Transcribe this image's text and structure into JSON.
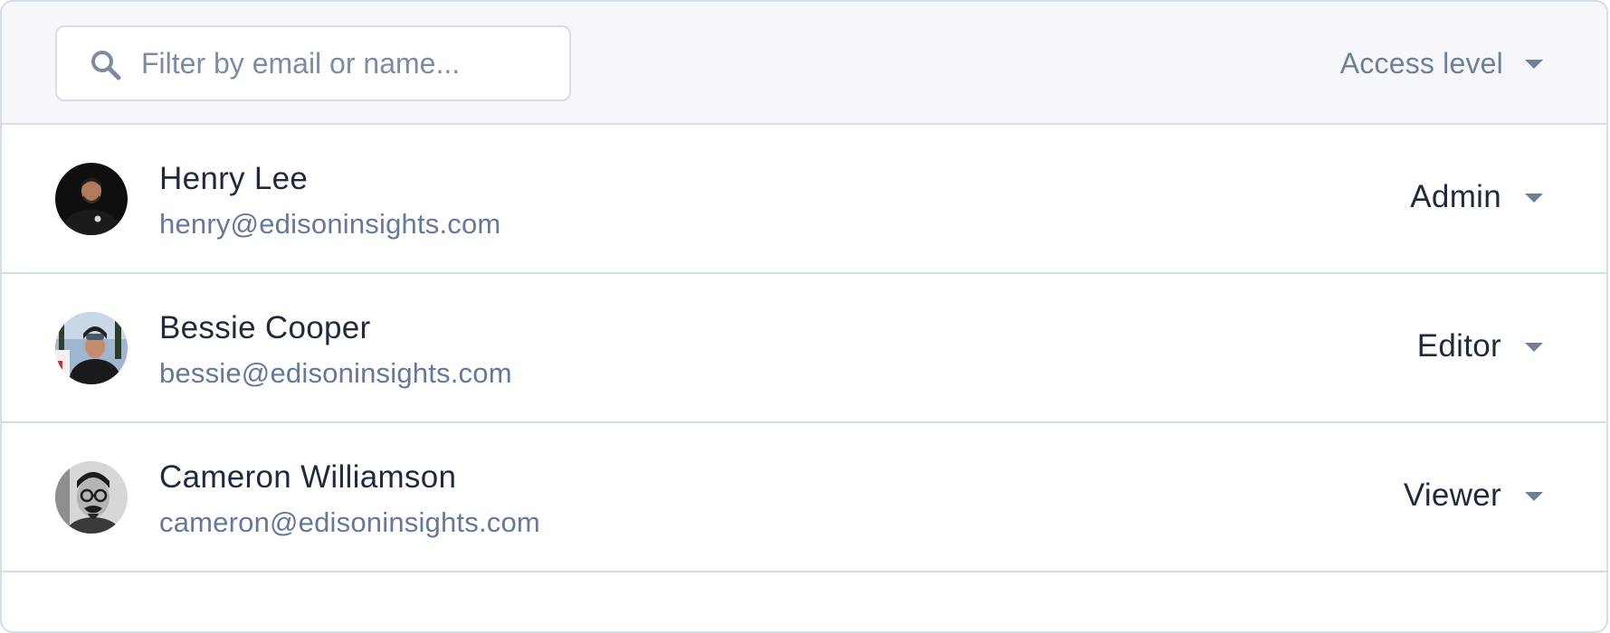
{
  "toolbar": {
    "search": {
      "placeholder": "Filter by email or name...",
      "value": "",
      "icon": "search-icon"
    },
    "access_filter": {
      "label": "Access level",
      "icon": "chevron-down-icon"
    }
  },
  "users": [
    {
      "name": "Henry Lee",
      "email": "henry@edisoninsights.com",
      "role": "Admin",
      "avatar": "avatar-henry"
    },
    {
      "name": "Bessie Cooper",
      "email": "bessie@edisoninsights.com",
      "role": "Editor",
      "avatar": "avatar-bessie"
    },
    {
      "name": "Cameron Williamson",
      "email": "cameron@edisoninsights.com",
      "role": "Viewer",
      "avatar": "avatar-cameron"
    }
  ],
  "colors": {
    "border": "#d5dde6",
    "toolbar_bg": "#f5f7fa",
    "text_primary": "#1f2a3c",
    "text_secondary": "#65789a",
    "muted": "#6e7f96"
  }
}
